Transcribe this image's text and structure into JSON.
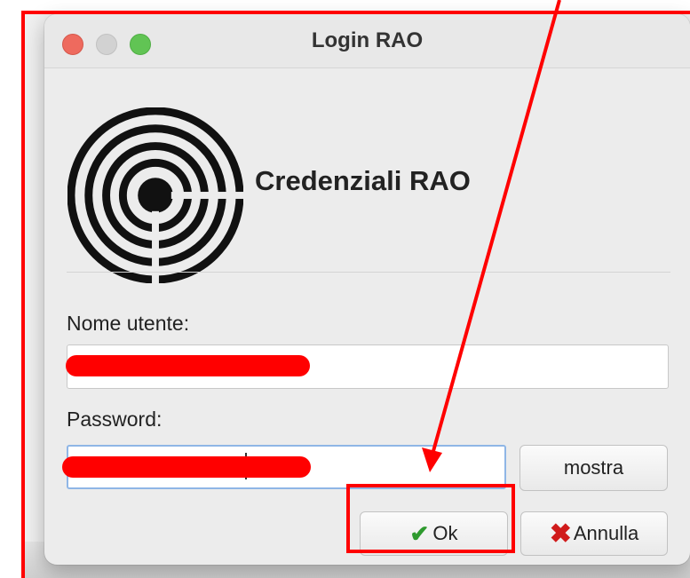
{
  "window": {
    "title": "Login RAO"
  },
  "header": {
    "heading": "Credenziali RAO",
    "logo_icon": "concentric-rings-logo"
  },
  "form": {
    "username_label": "Nome utente:",
    "username_value": "",
    "password_label": "Password:",
    "password_value": "",
    "show_button_label": "mostra"
  },
  "actions": {
    "ok_label": "Ok",
    "ok_icon": "checkmark-icon",
    "cancel_label": "Annulla",
    "cancel_icon": "red-x-icon"
  },
  "colors": {
    "annotation": "#ff0000",
    "ok_check": "#2e9a2e",
    "cancel_x": "#d01b1b",
    "traffic_close": "#ee6a5e",
    "traffic_max": "#61c454"
  }
}
